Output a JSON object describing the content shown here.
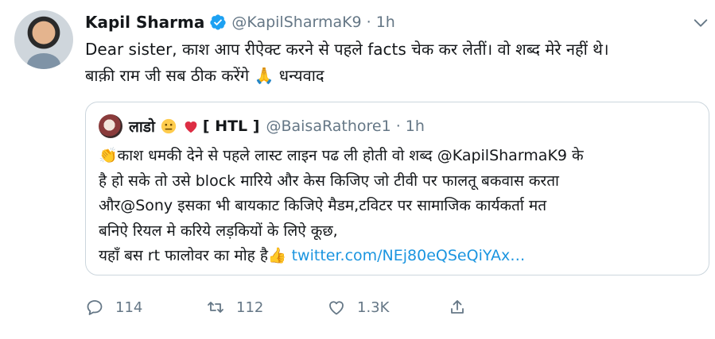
{
  "tweet": {
    "display_name": "Kapil Sharma",
    "handle": "@KapilSharmaK9",
    "separator": "·",
    "time": "1h",
    "text_lines": [
      "Dear sister, काश आप रीऐक्ट करने से पहले facts चेक कर लेतीं। वो शब्द मेरे नहीं थे।",
      "बाक़ी राम जी सब ठीक करेंगे 🙏 धन्यवाद"
    ]
  },
  "quoted": {
    "display_name": "लाडो",
    "tag": "[ HTL ]",
    "handle": "@BaisaRathore1",
    "separator": "·",
    "time": "1h",
    "text_lines": [
      "👏काश धमकी देने से पहले लास्ट लाइन पढ ली होती वो शब्द @KapilSharmaK9 के",
      "है हो सके तो उसे  block मारिये और केस किजिए जो टीवी पर फालतू बकवास करता",
      "और@Sony इसका भी बायकाट किजिऐ मैडम,टविटर पर सामाजिक कार्यकर्ता मत",
      "बनिऐ रियल मे करिये लड़कियों के लिऐ कूछ,"
    ],
    "last_line_text": "यहाँ बस rt फालोवर का मोह है👍 ",
    "link": "twitter.com/NEj80eQSeQiYAx…"
  },
  "actions": {
    "reply_count": "114",
    "retweet_count": "112",
    "like_count": "1.3K"
  },
  "colors": {
    "text": "#14171a",
    "muted": "#657786",
    "link": "#1b95e0",
    "verified": "#1da1f2",
    "border": "#ccd6dd"
  }
}
